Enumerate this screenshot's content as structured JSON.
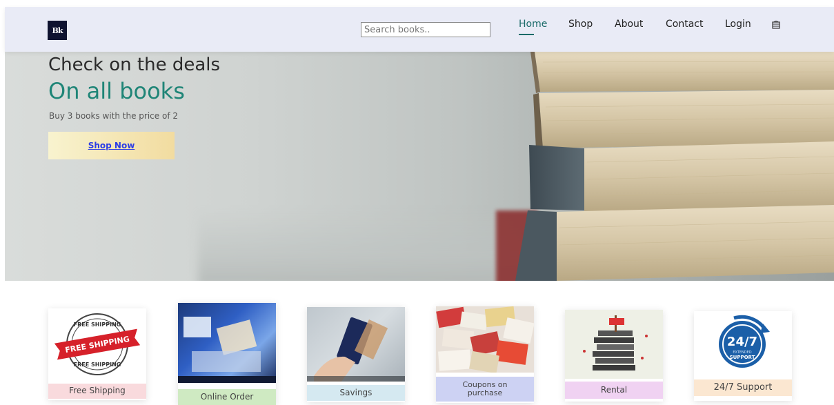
{
  "navbar": {
    "logo_text": "Bk",
    "search_placeholder": "Search books..",
    "links": [
      "Home",
      "Shop",
      "About",
      "Contact",
      "Login"
    ],
    "active_link": "Home",
    "cart_icon": "cart-icon"
  },
  "hero": {
    "title_line1": "Check on the deals",
    "title_line2": "On all books",
    "subtitle": "Buy 3 books with the price of 2",
    "cta_label": "Shop Now"
  },
  "features": [
    {
      "label": "Free Shipping",
      "label_bg": "#f9dadd"
    },
    {
      "label": "Online Order",
      "label_bg": "#cfeac2"
    },
    {
      "label": "Savings",
      "label_bg": "#d5e9f1"
    },
    {
      "label": "Coupons on purchase",
      "label_bg": "#cdd2f3"
    },
    {
      "label": "Rental",
      "label_bg": "#f0d2f2"
    },
    {
      "label": "24/7 Support",
      "label_bg": "#fbe7d1"
    }
  ],
  "badges": {
    "free_shipping_top": "FREE SHIPPING",
    "free_shipping_banner": "FREE SHIPPING",
    "free_shipping_bottom": "FREE SHIPPING",
    "support_main": "24/7",
    "support_line1": "EXTENDED",
    "support_line2": "SUPPORT"
  },
  "colors": {
    "accent": "#1f8577",
    "nav_bg": "#e9ebf6",
    "cta_start": "#f8f3cf",
    "cta_end": "#f2dca0"
  }
}
